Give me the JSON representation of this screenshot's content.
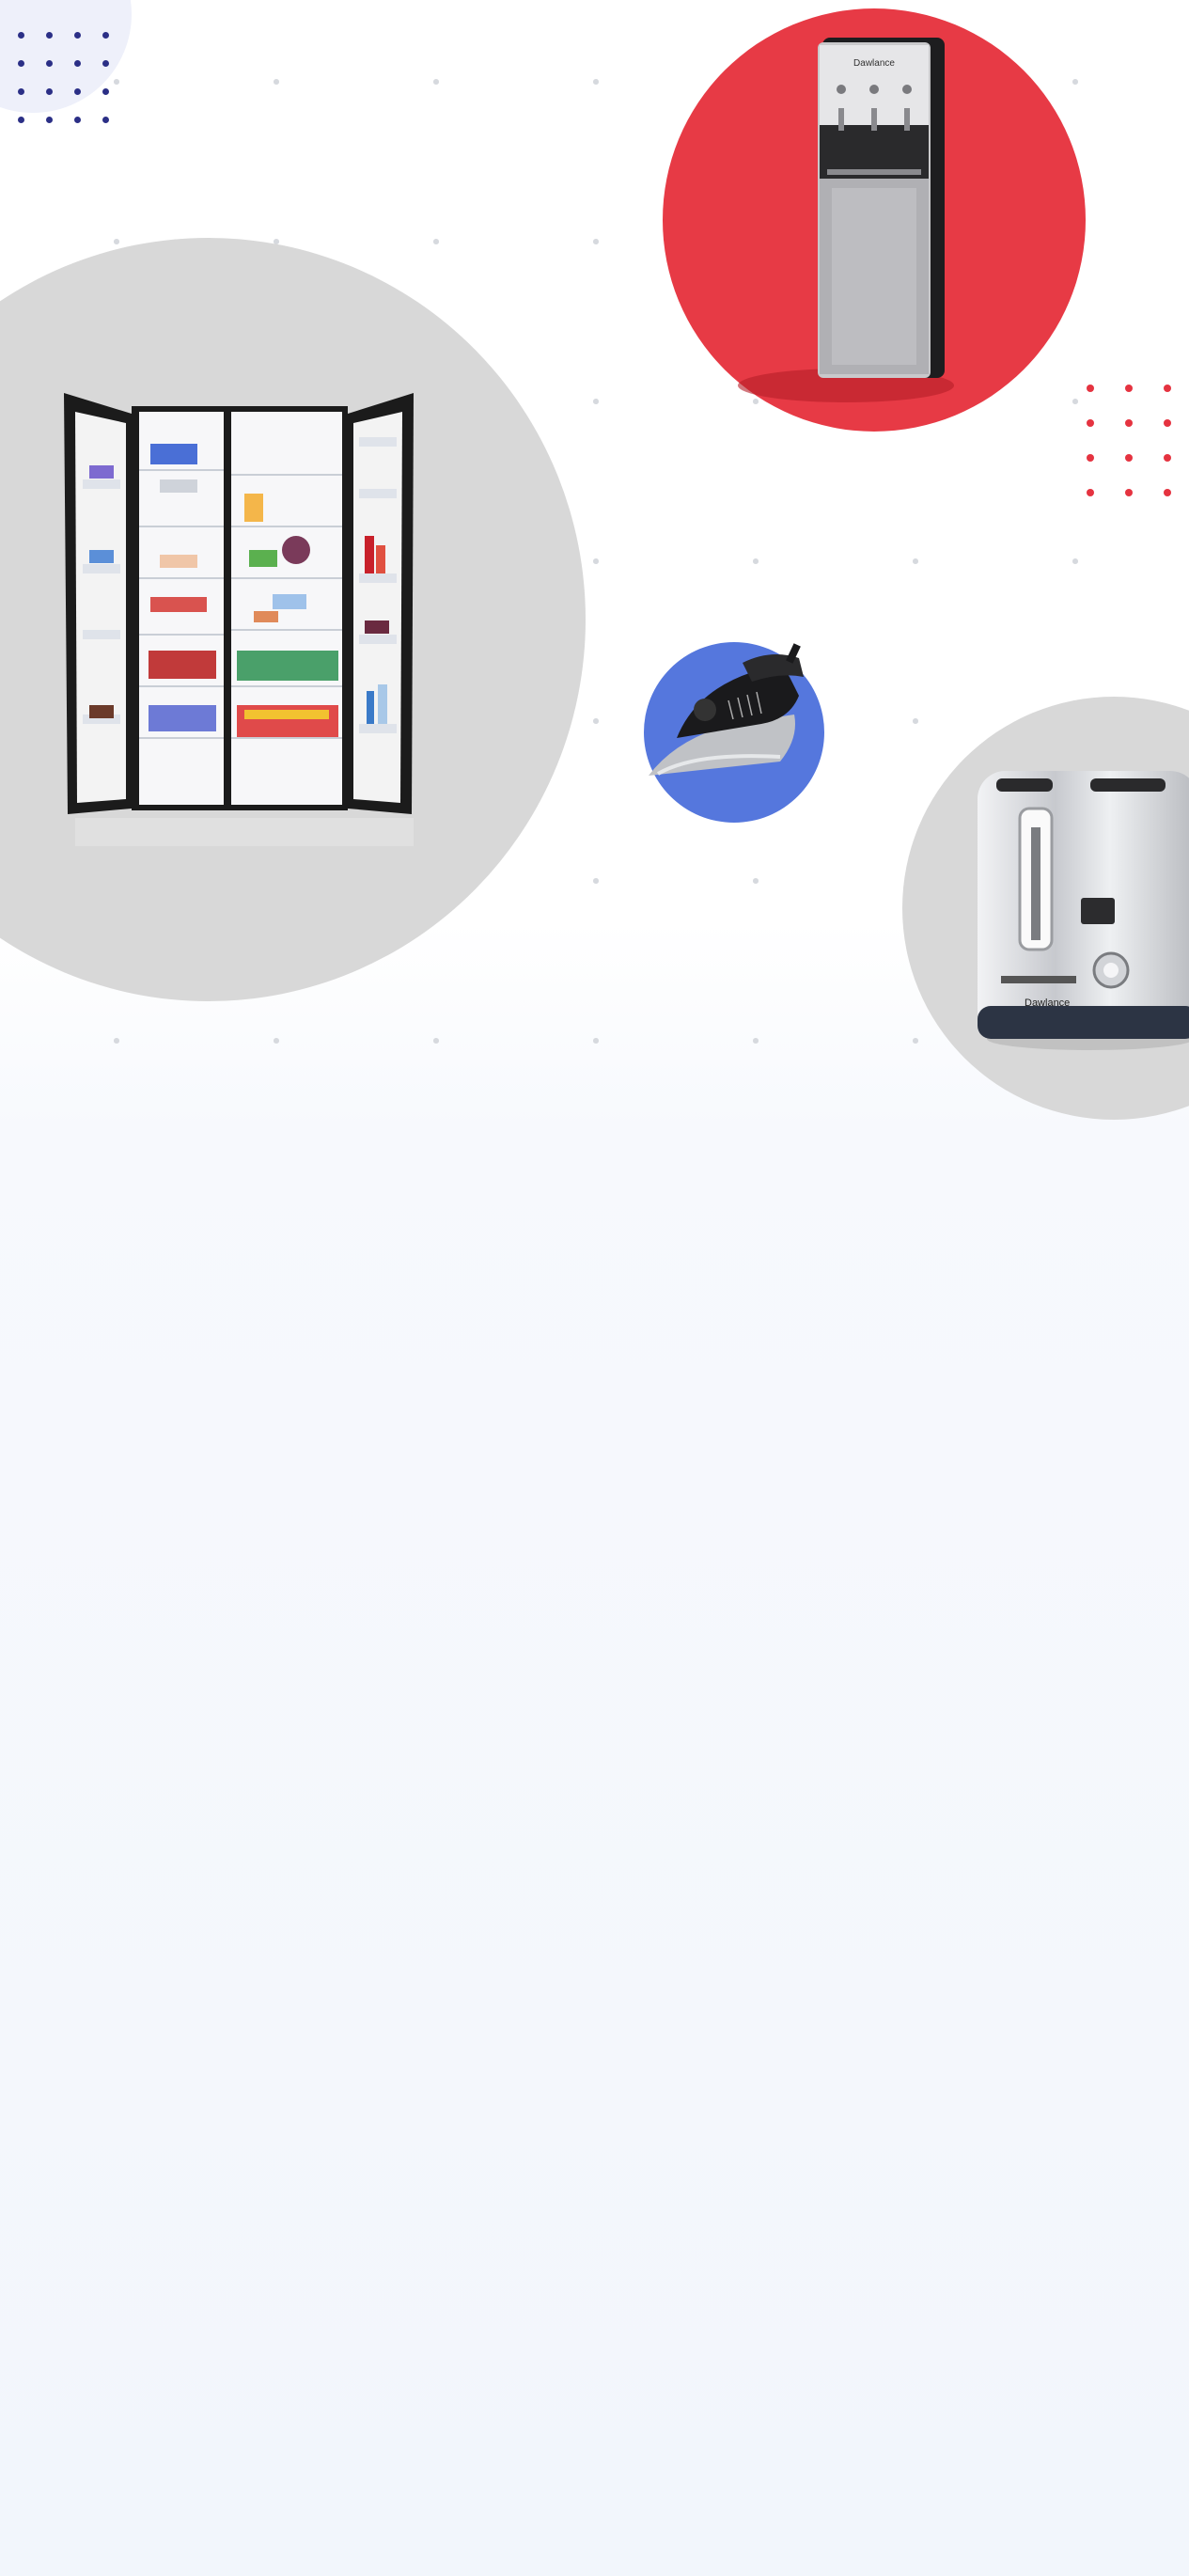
{
  "page": {
    "background_top": "#ffffff",
    "background_bottom": "#f2f6fc"
  },
  "colors": {
    "grid_dot": "#d6d9de",
    "navy_dot": "#2b2f86",
    "red_dot": "#e53340",
    "red_circle": "#e73a45",
    "grey_circle": "#d8d8d8",
    "blue_circle": "#5577dd",
    "lavender_corner": "#eef0fa"
  },
  "products": [
    {
      "id": "water-dispenser",
      "icon": "water-dispenser-icon",
      "brand_text": "Dawlance"
    },
    {
      "id": "refrigerator",
      "icon": "refrigerator-icon",
      "brand_text": ""
    },
    {
      "id": "iron",
      "icon": "iron-icon",
      "brand_text": ""
    },
    {
      "id": "toaster",
      "icon": "toaster-icon",
      "brand_text": "Dawlance"
    }
  ]
}
